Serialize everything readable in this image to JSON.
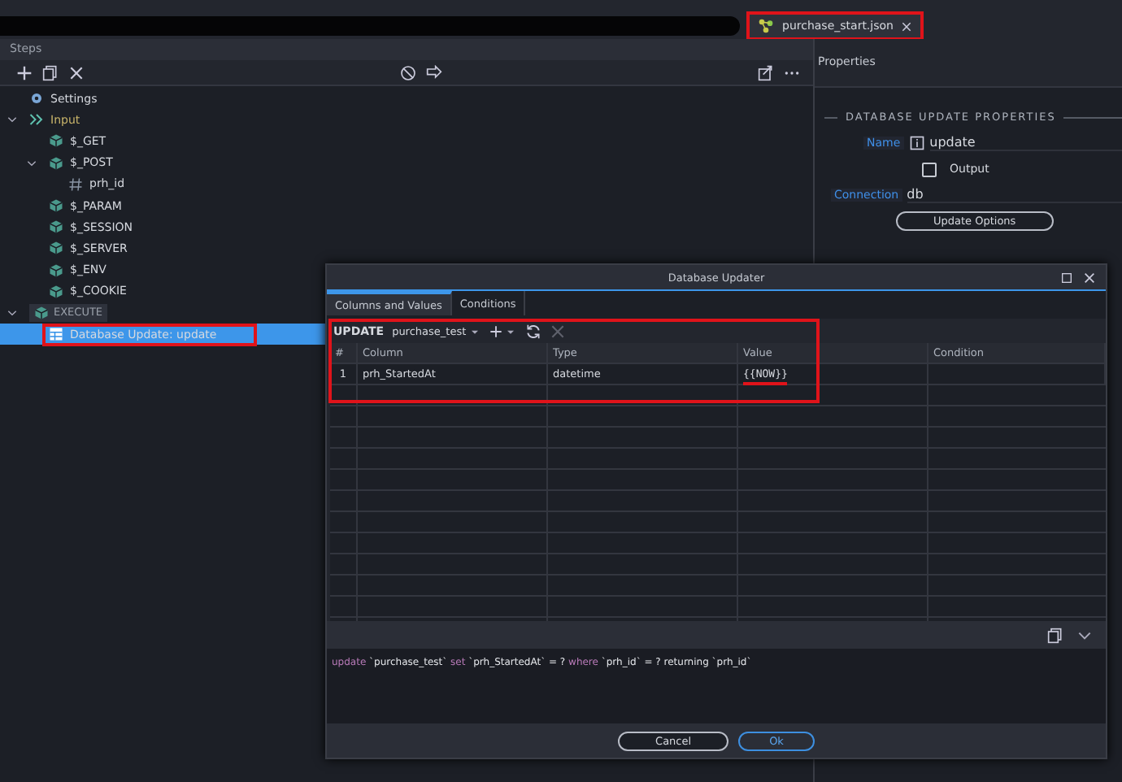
{
  "file_tab": {
    "label": "purchase_start.json",
    "highlighted": true
  },
  "steps_panel": {
    "title": "Steps"
  },
  "tree": [
    {
      "label": "Settings",
      "kind": "settings",
      "selected": false
    },
    {
      "label": "Input",
      "kind": "group",
      "expanded": true,
      "selected": false,
      "children": [
        {
          "label": "$_GET",
          "kind": "variable",
          "selected": false
        },
        {
          "label": "$_POST",
          "kind": "variable",
          "expanded": true,
          "selected": false,
          "children": [
            {
              "label": "prh_id",
              "kind": "field",
              "selected": false
            }
          ]
        },
        {
          "label": "$_PARAM",
          "kind": "variable",
          "selected": false
        },
        {
          "label": "$_SESSION",
          "kind": "variable",
          "selected": false
        },
        {
          "label": "$_SERVER",
          "kind": "variable",
          "selected": false
        },
        {
          "label": "$_ENV",
          "kind": "variable",
          "selected": false
        },
        {
          "label": "$_COOKIE",
          "kind": "variable",
          "selected": false
        }
      ]
    },
    {
      "label": "EXECUTE",
      "kind": "action",
      "expanded": true,
      "selected": false,
      "children": [
        {
          "label": "Database Update: update",
          "kind": "step",
          "selected": true,
          "highlighted": true
        }
      ]
    }
  ],
  "properties": {
    "title": "Properties",
    "section": "DATABASE UPDATE PROPERTIES",
    "name_label": "Name",
    "name_value": "update",
    "output_label": "Output",
    "output_checked": false,
    "connection_label": "Connection",
    "connection_value": "db",
    "options_button": "Update Options"
  },
  "dialog": {
    "title": "Database Updater",
    "tabs": [
      {
        "label": "Columns and Values",
        "selected": true
      },
      {
        "label": "Conditions",
        "selected": false
      }
    ],
    "keyword": "UPDATE",
    "table_name": "purchase_test",
    "toolbar_highlighted": true,
    "columns": [
      "#",
      "Column",
      "Type",
      "Value",
      "Condition"
    ],
    "rows": [
      {
        "index": "1",
        "column": "prh_StartedAt",
        "type": "datetime",
        "value": "{{NOW}}",
        "value_underlined": true
      }
    ],
    "sql": [
      {
        "kind": "keyword",
        "text": "update"
      },
      {
        "kind": "text",
        "text": " `purchase_test` "
      },
      {
        "kind": "keyword",
        "text": "set"
      },
      {
        "kind": "text",
        "text": " `prh_StartedAt` = ? "
      },
      {
        "kind": "keyword",
        "text": "where"
      },
      {
        "kind": "text",
        "text": " `prh_id` = ? returning `prh_id`"
      }
    ],
    "buttons": [
      {
        "label": "Cancel",
        "kind": "secondary"
      },
      {
        "label": "Ok",
        "kind": "primary"
      }
    ]
  }
}
